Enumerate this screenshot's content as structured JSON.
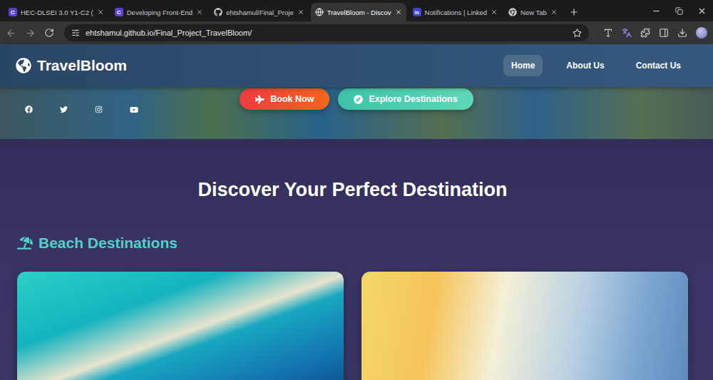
{
  "browser": {
    "tabs": [
      {
        "label": "HEC-DLSEI 3.0 Y1-C2 (",
        "selected": false,
        "kind": "coursera",
        "icon_text": "C"
      },
      {
        "label": "Developing Front-End",
        "selected": false,
        "kind": "coursera",
        "icon_text": "C"
      },
      {
        "label": "ehtshamul/Final_Proje",
        "selected": false,
        "kind": "github"
      },
      {
        "label": "TravelBloom - Discov",
        "selected": true,
        "kind": "site"
      },
      {
        "label": "Notifications | Linked",
        "selected": false,
        "kind": "linkedin",
        "icon_text": "in"
      },
      {
        "label": "New Tab",
        "selected": false,
        "kind": "chrome"
      }
    ],
    "address": "ehtshamul.github.io/Final_Project_TravelBloom/"
  },
  "navbar": {
    "logo": "TravelBloom",
    "links": [
      {
        "label": "Home",
        "selected": true
      },
      {
        "label": "About Us",
        "selected": false
      },
      {
        "label": "Contact Us",
        "selected": false
      }
    ]
  },
  "hero": {
    "buttons": [
      {
        "label": "Book Now",
        "kind": "primary"
      },
      {
        "label": "Explore Destinations",
        "kind": "secondary"
      }
    ]
  },
  "section": {
    "title": "Discover Your Perfect Destination",
    "category": "Beach Destinations",
    "cards": [
      {
        "kind": "lagoon"
      },
      {
        "kind": "sunset"
      }
    ]
  }
}
